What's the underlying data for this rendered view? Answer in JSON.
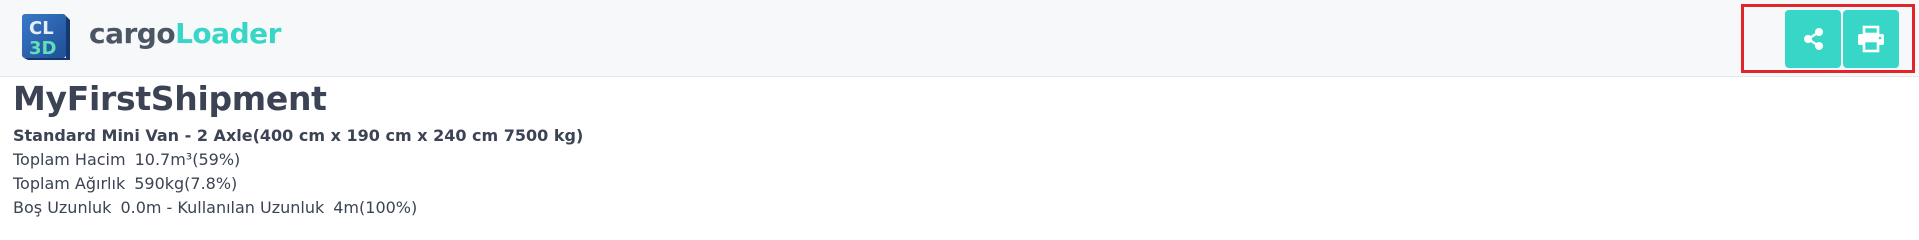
{
  "header": {
    "logo_text": "CL3D",
    "brand_part1": "cargo",
    "brand_part2": "Loader",
    "brand_colors": {
      "part1": "#4b5563",
      "part2": "#38d6c7"
    },
    "actions": [
      {
        "icon": "share-icon"
      },
      {
        "icon": "print-icon"
      }
    ],
    "action_color": "#38d6c7",
    "highlight_color": "#e0262b"
  },
  "shipment": {
    "title": "MyFirstShipment",
    "vehicle": "Standard Mini Van - 2 Axle(400 cm x 190 cm x 240 cm 7500 kg)",
    "total_volume_label": "Toplam Hacim",
    "total_volume_value": "10.7m³(59%)",
    "total_weight_label": "Toplam Ağırlık",
    "total_weight_value": "590kg(7.8%)",
    "empty_length_label": "Boş Uzunluk",
    "empty_length_value": "0.0m - Kullanılan Uzunluk",
    "used_length_value": "4m(100%)"
  }
}
